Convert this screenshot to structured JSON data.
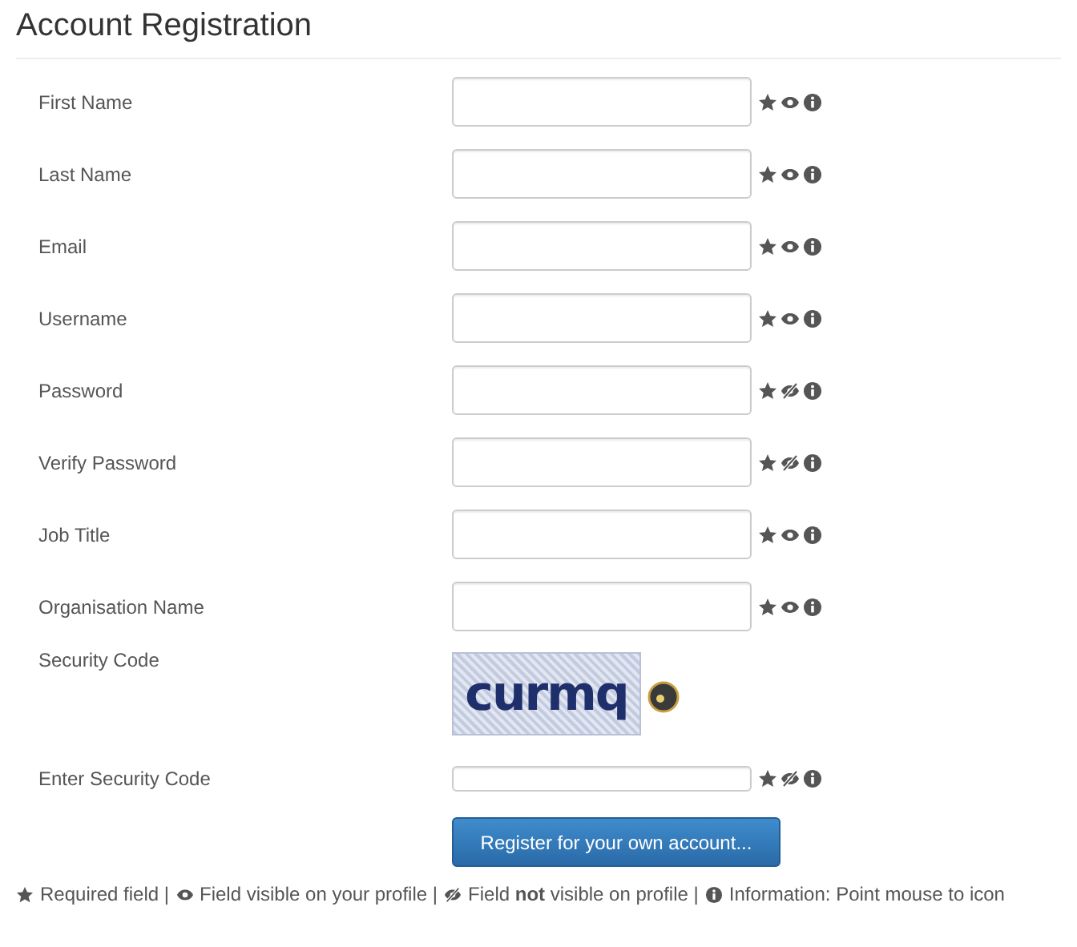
{
  "title": "Account Registration",
  "fields": [
    {
      "label": "First Name",
      "kind": "text",
      "required": true,
      "visible": true
    },
    {
      "label": "Last Name",
      "kind": "text",
      "required": true,
      "visible": true
    },
    {
      "label": "Email",
      "kind": "text",
      "required": true,
      "visible": true
    },
    {
      "label": "Username",
      "kind": "text",
      "required": true,
      "visible": true
    },
    {
      "label": "Password",
      "kind": "text",
      "required": true,
      "visible": false
    },
    {
      "label": "Verify Password",
      "kind": "text",
      "required": true,
      "visible": false
    },
    {
      "label": "Job Title",
      "kind": "text",
      "required": true,
      "visible": true
    },
    {
      "label": "Organisation Name",
      "kind": "text",
      "required": true,
      "visible": true
    },
    {
      "label": "Security Code",
      "kind": "captcha",
      "captcha_text": "curmq"
    },
    {
      "label": "Enter Security Code",
      "kind": "small",
      "required": true,
      "visible": false
    }
  ],
  "button": "Register for your own account...",
  "legend": [
    {
      "kind": "required",
      "text": "Required field |"
    },
    {
      "kind": "visible",
      "text": "Field visible on your profile |"
    },
    {
      "kind": "hidden",
      "text": "Field **not** visible on profile |"
    },
    {
      "kind": "info",
      "text": "Information: Point mouse to icon"
    }
  ]
}
